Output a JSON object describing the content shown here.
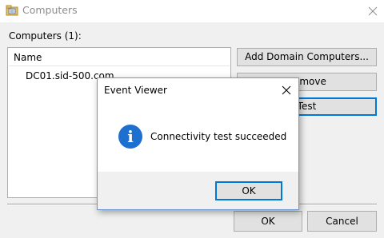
{
  "window": {
    "title": "Computers",
    "icon": "computers-folder-icon",
    "close_icon": "close-icon"
  },
  "computers": {
    "label": "Computers (1):",
    "column_header": "Name",
    "items": [
      "DC01.sid-500.com"
    ]
  },
  "side_buttons": {
    "add": "Add Domain Computers...",
    "remove": "Remove",
    "test": "Test"
  },
  "footer_buttons": {
    "ok": "OK",
    "cancel": "Cancel"
  },
  "dialog": {
    "title": "Event Viewer",
    "message": "Connectivity test succeeded",
    "icon": "information-icon",
    "ok": "OK"
  },
  "colors": {
    "accent": "#0078d7",
    "info_icon": "#1d6fd0"
  }
}
